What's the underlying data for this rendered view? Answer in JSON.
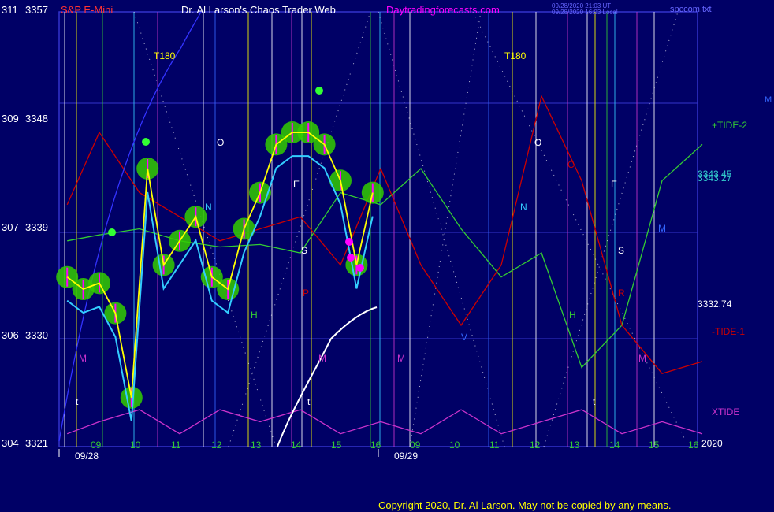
{
  "header": {
    "symbol": "S&P E-Mini",
    "title": "Dr. Al Larson's Chaos Trader Web",
    "site": "Daytradingforecasts.com",
    "timestamp_line1": "09/28/2020 21:03 UT",
    "timestamp_line2": "09/28/2020 16:03 Local",
    "file": "spccom.txt"
  },
  "copyright": "Copyright 2020, Dr. Al Larson. May not be copied by any means.",
  "colors": {
    "background": "#000066",
    "frame": "#3333cc",
    "price_bars": "#ff00ff",
    "price_glow": "#33cc00",
    "avg_fast": "#ffff00",
    "avg_slow": "#33ccff",
    "tide_plus2": "#33cc33",
    "tide_minus1": "#cc0000",
    "xtide": "#cc33cc",
    "white_line": "#ffffff"
  },
  "chart_data": {
    "type": "line",
    "y_axis": {
      "ticks": [
        {
          "left": "311",
          "right": "3357",
          "value": 3357
        },
        {
          "left": "309",
          "right": "3348",
          "value": 3348
        },
        {
          "left": "307",
          "right": "3339",
          "value": 3339
        },
        {
          "left": "306",
          "right": "3330",
          "value": 3330
        },
        {
          "left": "304",
          "right": "3321",
          "value": 3321
        }
      ],
      "range": [
        3321,
        3357
      ]
    },
    "x_axis": {
      "hour_labels": [
        "09",
        "10",
        "11",
        "12",
        "13",
        "14",
        "15",
        "16",
        "09",
        "10",
        "11",
        "12",
        "13",
        "14",
        "15",
        "16"
      ],
      "date_labels": [
        "09/28",
        "09/29"
      ],
      "year_label": "2020"
    },
    "right_labels": [
      {
        "text": "+TIDE-2",
        "color": "#33cc33"
      },
      {
        "text": "3343.45",
        "color": "#33cccc"
      },
      {
        "text": "3343.27",
        "color": "#33cccc"
      },
      {
        "text": "3332.74",
        "color": "#ffffff"
      },
      {
        "text": "-TIDE-1",
        "color": "#cc0000"
      },
      {
        "text": "XTIDE",
        "color": "#cc33cc"
      }
    ],
    "line_markers": [
      {
        "text": "T180",
        "color": "#ffff00"
      },
      {
        "text": "T180",
        "color": "#ffff00"
      },
      {
        "text": "O",
        "color": "#ffffff"
      },
      {
        "text": "O",
        "color": "#ffffff"
      },
      {
        "text": "N",
        "color": "#33ccff"
      },
      {
        "text": "N",
        "color": "#33ccff"
      },
      {
        "text": "E",
        "color": "#ffffff"
      },
      {
        "text": "E",
        "color": "#ffffff"
      },
      {
        "text": "C",
        "color": "#cc0000"
      },
      {
        "text": "S",
        "color": "#ffffff"
      },
      {
        "text": "S",
        "color": "#ffffff"
      },
      {
        "text": "P",
        "color": "#cc0000"
      },
      {
        "text": "R",
        "color": "#cc0000"
      },
      {
        "text": "H",
        "color": "#33cc33"
      },
      {
        "text": "H",
        "color": "#33cc33"
      },
      {
        "text": "M",
        "color": "#cc33cc"
      },
      {
        "text": "M",
        "color": "#cc33cc"
      },
      {
        "text": "M",
        "color": "#cc33cc"
      },
      {
        "text": "M",
        "color": "#cc33cc"
      },
      {
        "text": "V",
        "color": "#3366ff"
      },
      {
        "text": "t",
        "color": "#ffffff"
      },
      {
        "text": "t",
        "color": "#ffffff"
      },
      {
        "text": "t",
        "color": "#ffffff"
      },
      {
        "text": "M",
        "color": "#3366ff"
      }
    ],
    "series": [
      {
        "name": "+TIDE-2",
        "x_hours": [
          8.2,
          9,
          10,
          11,
          12,
          13,
          14,
          15,
          16,
          17,
          18,
          19,
          20,
          21,
          22,
          23,
          24
        ],
        "values": [
          3338,
          3338.5,
          3339,
          3338,
          3337.5,
          3337.7,
          3337,
          3342,
          3341,
          3344,
          3339,
          3335,
          3337,
          3327.5,
          3331,
          3343,
          3346
        ]
      },
      {
        "name": "-TIDE-1",
        "x_hours": [
          8.2,
          9,
          10,
          11,
          12,
          13,
          14,
          15,
          16,
          17,
          18,
          19,
          20,
          21,
          22,
          23,
          24
        ],
        "values": [
          3341,
          3347,
          3342,
          3340,
          3338,
          3339,
          3340,
          3336,
          3344,
          3336,
          3331,
          3336,
          3350,
          3343,
          3331,
          3327,
          3328
        ]
      },
      {
        "name": "XTIDE",
        "x_hours": [
          8.2,
          9,
          10,
          11,
          12,
          13,
          14,
          15,
          16,
          17,
          18,
          19,
          20,
          21,
          22,
          23,
          24
        ],
        "values": [
          3322,
          3323,
          3324,
          3322,
          3324,
          3323,
          3324,
          3322,
          3323,
          3322,
          3324,
          3322,
          3323,
          3324,
          3322,
          3323,
          3322
        ]
      },
      {
        "name": "price",
        "x_hours": [
          8.2,
          8.6,
          9,
          9.4,
          9.8,
          10.2,
          10.6,
          11,
          11.4,
          11.8,
          12.2,
          12.6,
          13,
          13.4,
          13.8,
          14.2,
          14.6,
          15,
          15.4,
          15.8
        ],
        "values": [
          3335,
          3334,
          3334.5,
          3332,
          3325,
          3344,
          3336,
          3338,
          3340,
          3335,
          3334,
          3339,
          3342,
          3346,
          3347,
          3347,
          3346,
          3343,
          3336,
          3342
        ]
      }
    ]
  }
}
